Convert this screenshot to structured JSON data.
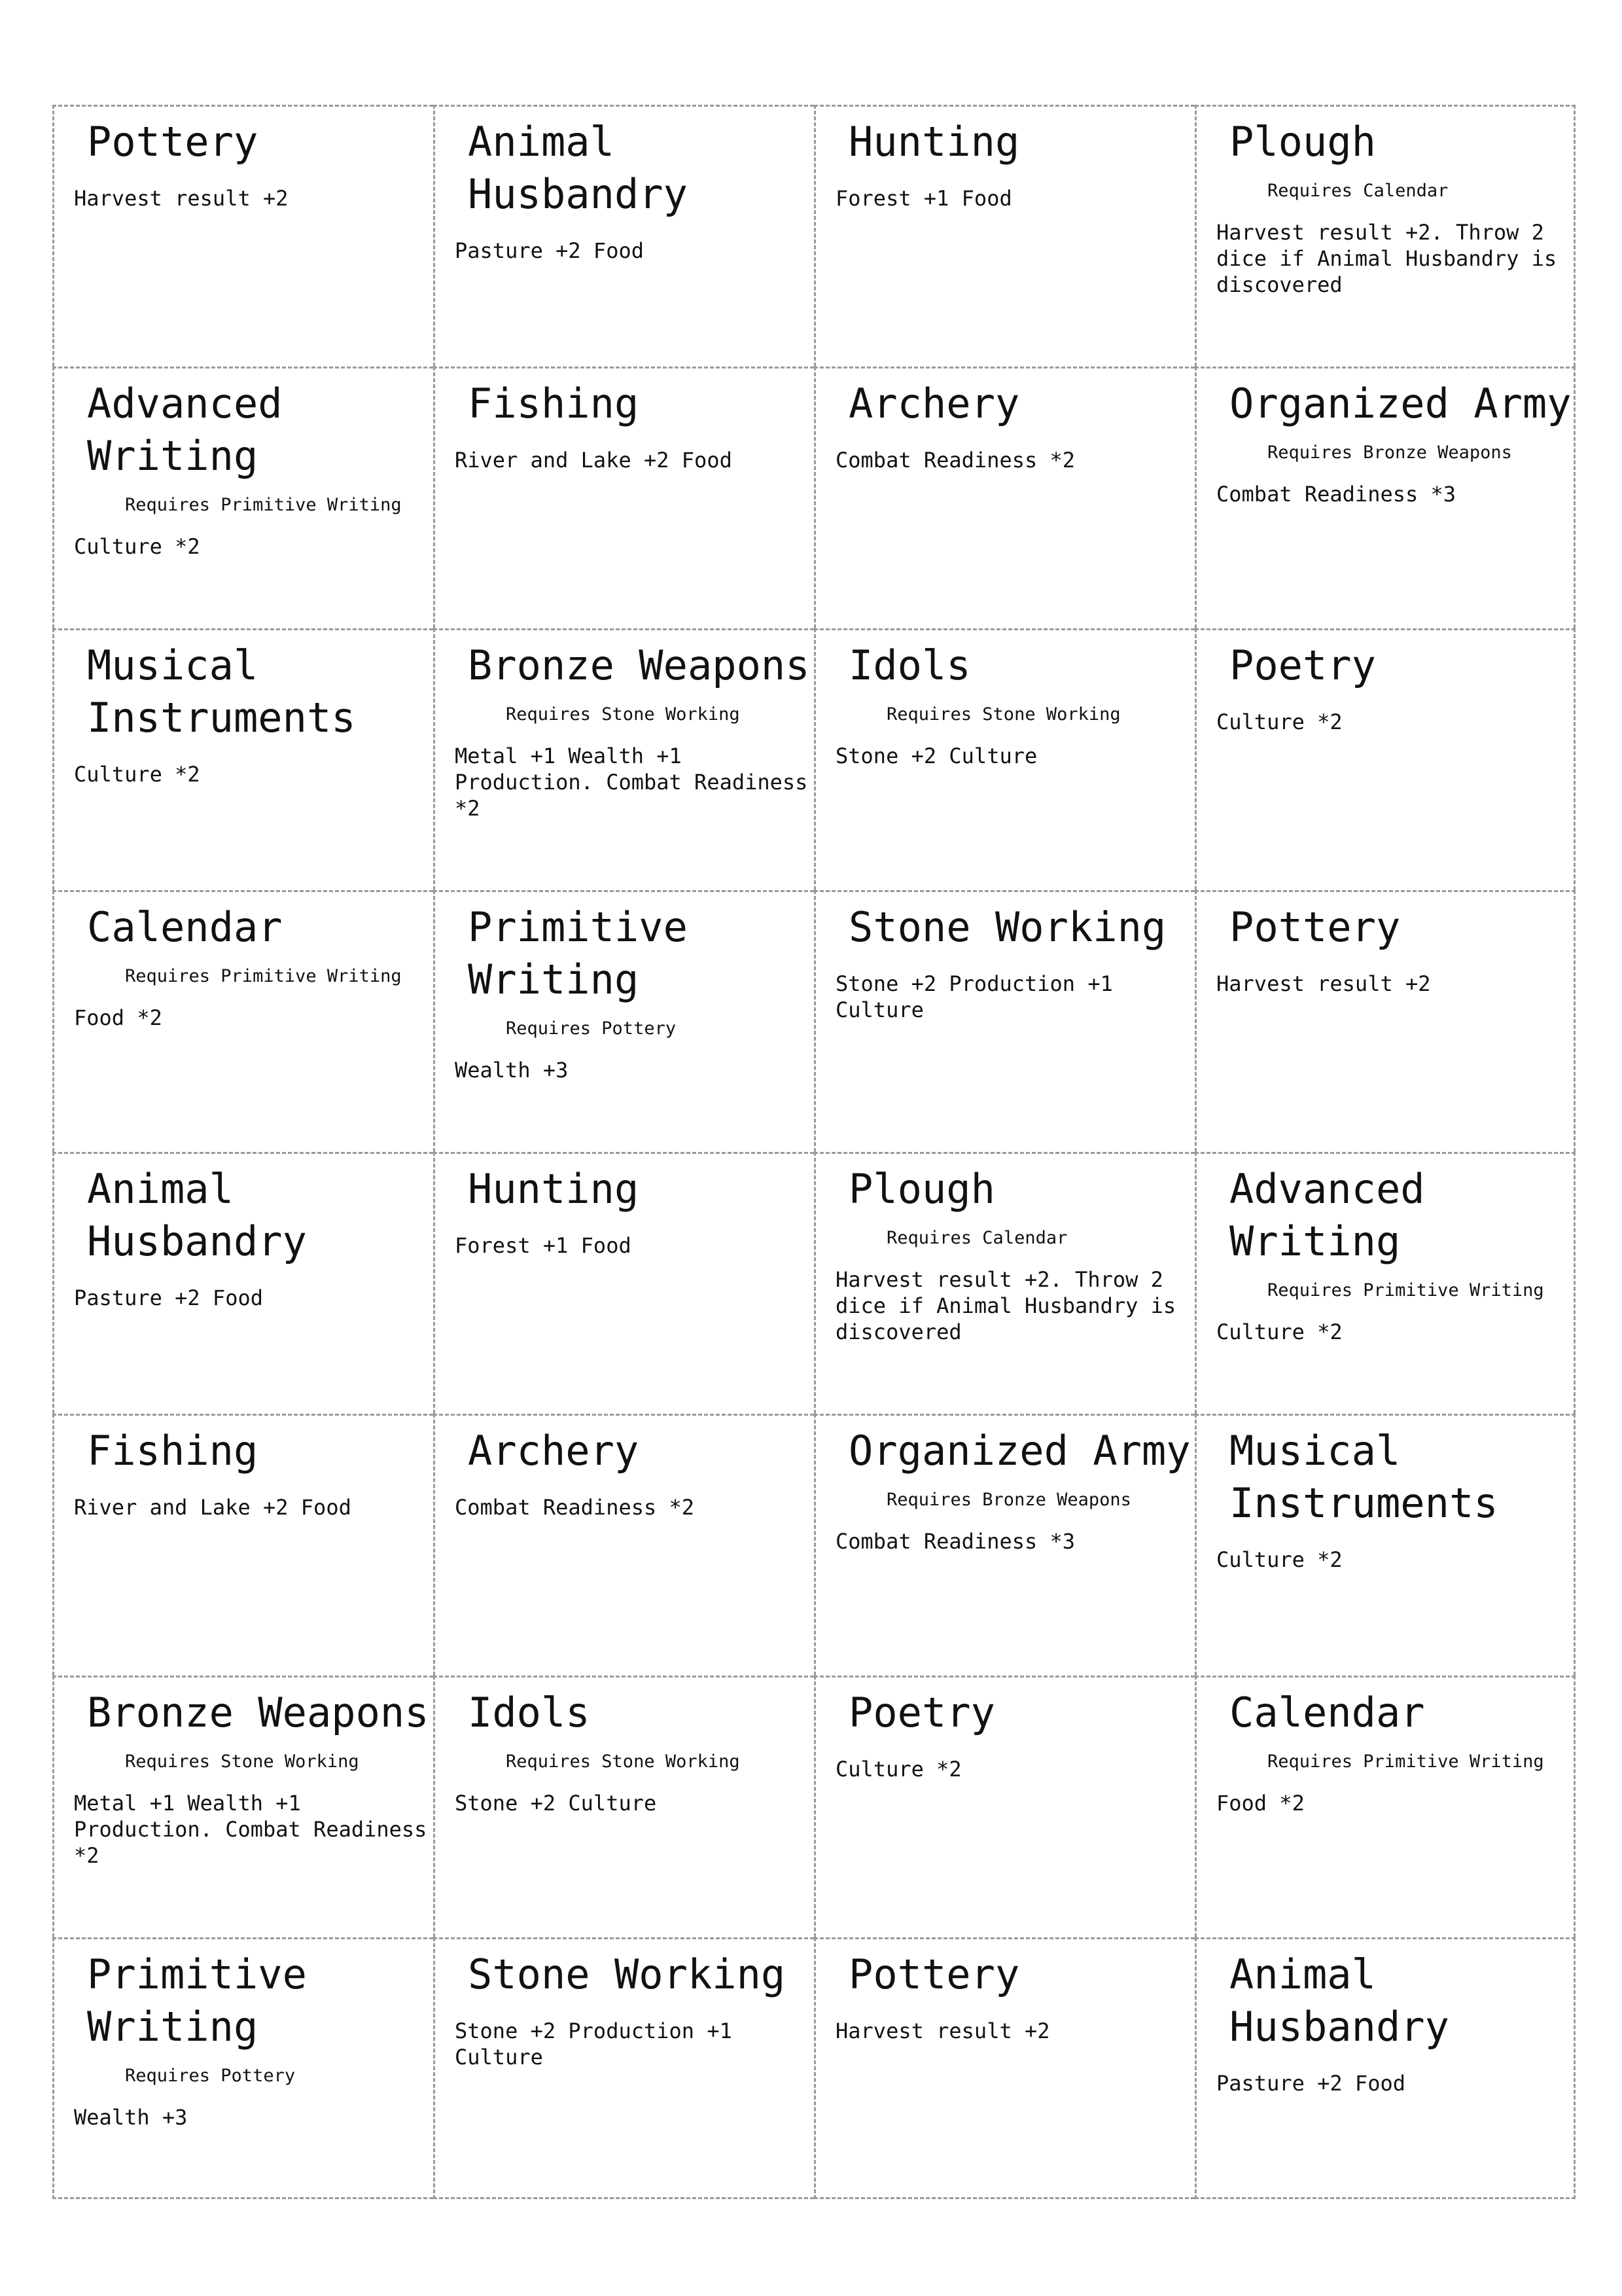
{
  "cards": [
    {
      "title": "Pottery",
      "requires": "",
      "effect": "Harvest result +2"
    },
    {
      "title": "Animal Husbandry",
      "requires": "",
      "effect": "Pasture +2 Food"
    },
    {
      "title": "Hunting",
      "requires": "",
      "effect": "Forest +1 Food"
    },
    {
      "title": "Plough",
      "requires": "Requires Calendar",
      "effect": "Harvest result +2. Throw 2 dice if Animal Husbandry is discovered"
    },
    {
      "title": "Advanced Writing",
      "requires": "Requires Primitive Writing",
      "effect": "Culture *2"
    },
    {
      "title": "Fishing",
      "requires": "",
      "effect": "River and Lake +2 Food"
    },
    {
      "title": "Archery",
      "requires": "",
      "effect": "Combat Readiness *2"
    },
    {
      "title": "Organized Army",
      "requires": "Requires Bronze Weapons",
      "effect": "Combat Readiness *3"
    },
    {
      "title": "Musical Instruments",
      "requires": "",
      "effect": "Culture *2"
    },
    {
      "title": "Bronze Weapons",
      "requires": "Requires Stone Working",
      "effect": "Metal +1 Wealth +1 Production. Combat Readiness *2"
    },
    {
      "title": "Idols",
      "requires": "Requires Stone Working",
      "effect": "Stone +2 Culture"
    },
    {
      "title": "Poetry",
      "requires": "",
      "effect": "Culture *2"
    },
    {
      "title": "Calendar",
      "requires": "Requires Primitive Writing",
      "effect": "Food *2"
    },
    {
      "title": "Primitive Writing",
      "requires": "Requires Pottery",
      "effect": "Wealth +3"
    },
    {
      "title": "Stone Working",
      "requires": "",
      "effect": "Stone +2 Production +1 Culture"
    },
    {
      "title": "Pottery",
      "requires": "",
      "effect": "Harvest result +2"
    },
    {
      "title": "Animal Husbandry",
      "requires": "",
      "effect": "Pasture +2 Food"
    },
    {
      "title": "Hunting",
      "requires": "",
      "effect": "Forest +1 Food"
    },
    {
      "title": "Plough",
      "requires": "Requires Calendar",
      "effect": "Harvest result +2. Throw 2 dice if Animal Husbandry is discovered"
    },
    {
      "title": "Advanced Writing",
      "requires": "Requires Primitive Writing",
      "effect": "Culture *2"
    },
    {
      "title": "Fishing",
      "requires": "",
      "effect": "River and Lake +2 Food"
    },
    {
      "title": "Archery",
      "requires": "",
      "effect": "Combat Readiness *2"
    },
    {
      "title": "Organized Army",
      "requires": "Requires Bronze Weapons",
      "effect": "Combat Readiness *3"
    },
    {
      "title": "Musical Instruments",
      "requires": "",
      "effect": "Culture *2"
    },
    {
      "title": "Bronze Weapons",
      "requires": "Requires Stone Working",
      "effect": "Metal +1 Wealth +1 Production. Combat Readiness *2"
    },
    {
      "title": "Idols",
      "requires": "Requires Stone Working",
      "effect": "Stone +2 Culture"
    },
    {
      "title": "Poetry",
      "requires": "",
      "effect": "Culture *2"
    },
    {
      "title": "Calendar",
      "requires": "Requires Primitive Writing",
      "effect": "Food *2"
    },
    {
      "title": "Primitive Writing",
      "requires": "Requires Pottery",
      "effect": "Wealth +3"
    },
    {
      "title": "Stone Working",
      "requires": "",
      "effect": "Stone +2 Production +1 Culture"
    },
    {
      "title": "Pottery",
      "requires": "",
      "effect": "Harvest result +2"
    },
    {
      "title": "Animal Husbandry",
      "requires": "",
      "effect": "Pasture +2 Food"
    }
  ]
}
